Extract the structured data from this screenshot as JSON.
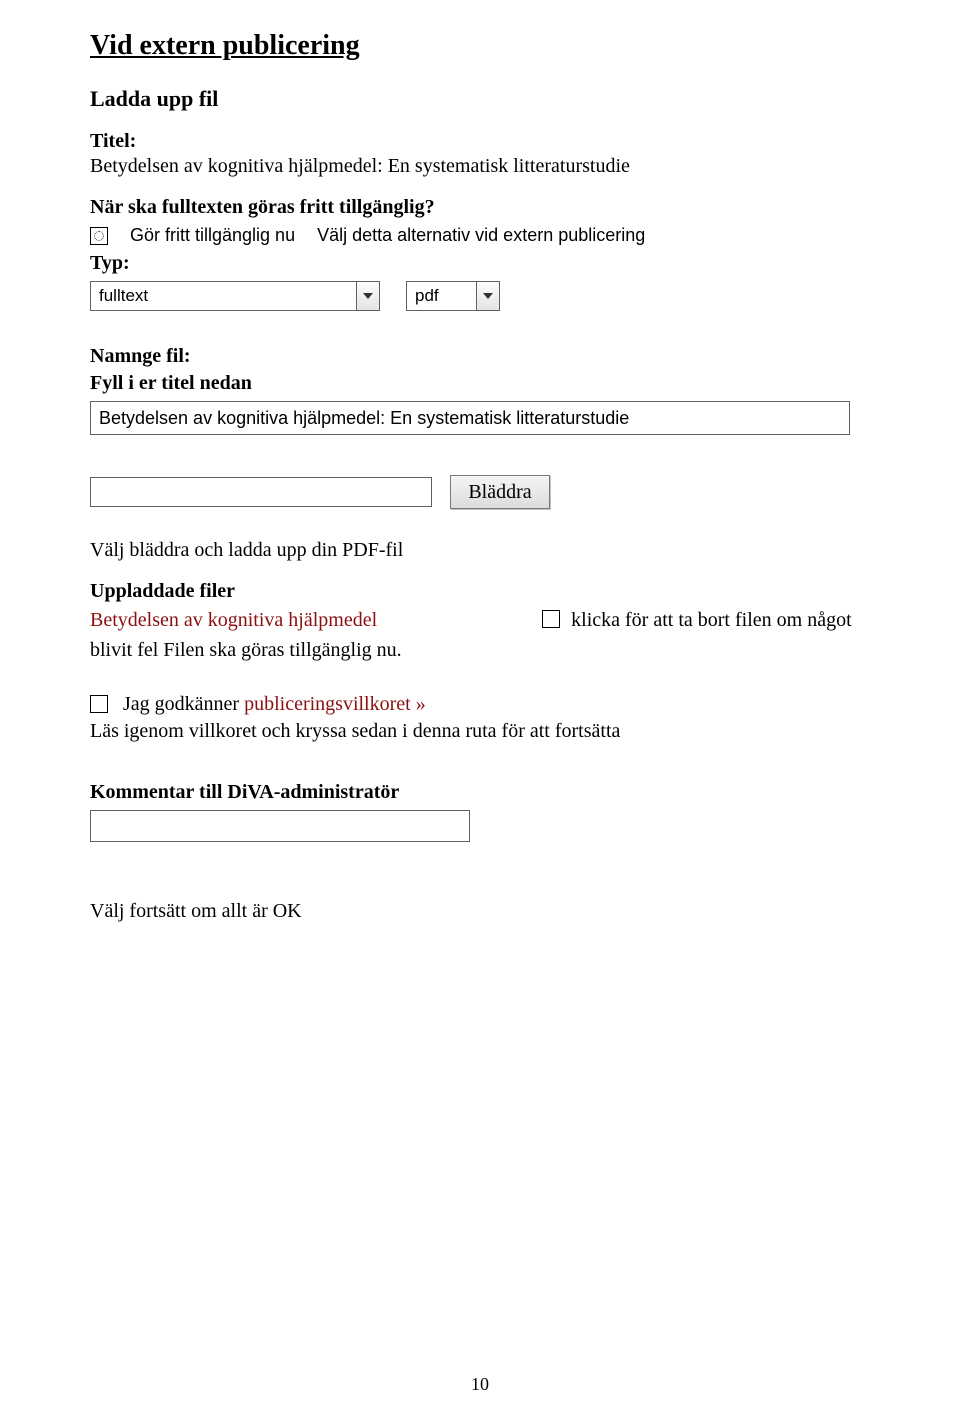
{
  "title": "Vid extern publicering",
  "upload_heading": "Ladda upp fil",
  "titel_label": "Titel:",
  "titel_value": "Betydelsen av kognitiva hjälpmedel: En systematisk litteraturstudie",
  "fulltext_q": "När ska fulltexten göras fritt tillgänglig?",
  "make_avail_label": "Gör fritt tillgänglig nu",
  "make_avail_hint": "Välj detta alternativ vid extern publicering",
  "type_label": "Typ:",
  "dropdown1": "fulltext",
  "dropdown2": "pdf",
  "namnge_label": "Namnge fil:",
  "namnge_sub": "Fyll i er titel nedan",
  "filename_value": "Betydelsen av kognitiva hjälpmedel: En systematisk litteraturstudie",
  "browse_label": "Bläddra",
  "browse_note": "Välj bläddra och ladda upp din PDF-fil",
  "uploaded_heading": "Uppladdade filer",
  "uploaded_link": "Betydelsen av kognitiva hjälpmedel",
  "delete_hint": "klicka för att ta bort filen om något",
  "uploaded_tail": "blivit fel Filen ska göras tillgänglig nu.",
  "consent_a": "Jag godkänner ",
  "consent_link": "publiceringsvillkoret »",
  "consent_note": " Läs igenom villkoret och kryssa sedan i denna ruta för att fortsätta",
  "comment_heading": "Kommentar till DiVA-administratör",
  "final_note": "Välj fortsätt om allt är OK",
  "page_number": "10"
}
